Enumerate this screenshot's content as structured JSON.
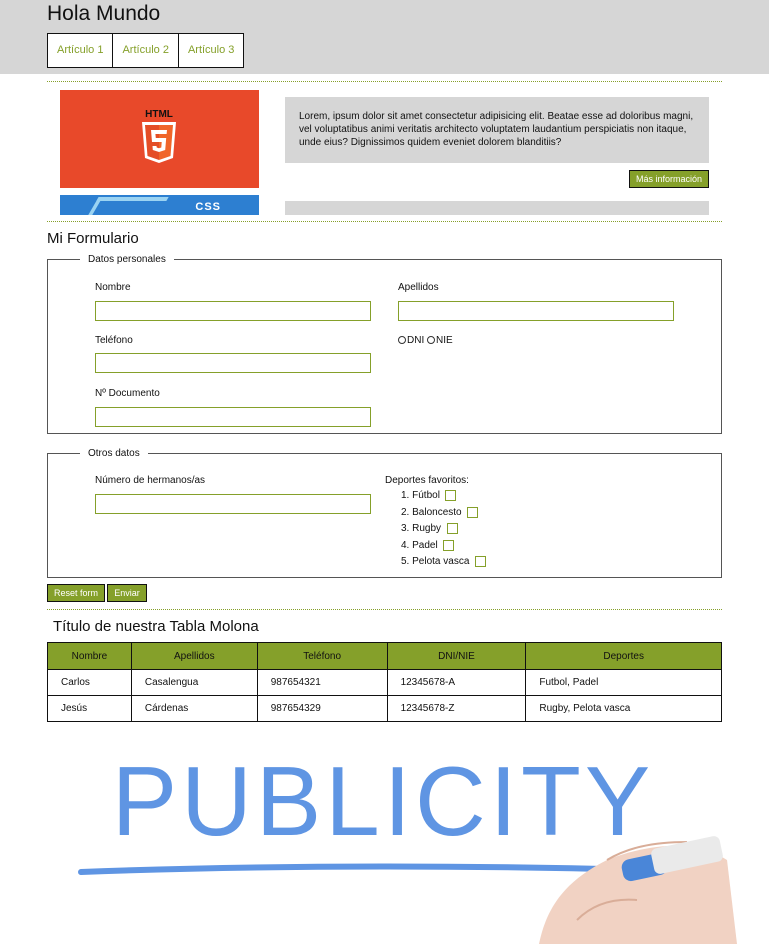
{
  "header": {
    "title": "Hola Mundo",
    "nav": [
      "Artículo 1",
      "Artículo 2",
      "Artículo 3"
    ]
  },
  "article": {
    "image_text": "HTML",
    "image2_text": "CSS",
    "text": "Lorem, ipsum dolor sit amet consectetur adipisicing elit. Beatae esse ad doloribus magni, vel voluptatibus animi veritatis architecto voluptatem laudantium perspiciatis non itaque, unde eius? Dignissimos quidem eveniet dolorem blanditiis?",
    "more_button": "Más información"
  },
  "form": {
    "title": "Mi Formulario",
    "personal": {
      "legend": "Datos personales",
      "nombre_label": "Nombre",
      "apellidos_label": "Apellidos",
      "telefono_label": "Teléfono",
      "dni_label": "DNI",
      "nie_label": "NIE",
      "documento_label": "Nº Documento"
    },
    "other": {
      "legend": "Otros datos",
      "hermanos_label": "Número de hermanos/as",
      "deportes_label": "Deportes favoritos:",
      "sports": [
        "1. Fútbol",
        "2. Baloncesto",
        "3. Rugby",
        "4. Padel",
        "5. Pelota vasca"
      ]
    },
    "reset_button": "Reset form",
    "submit_button": "Enviar"
  },
  "table": {
    "title": "Título de nuestra Tabla Molona",
    "headers": [
      "Nombre",
      "Apellidos",
      "Teléfono",
      "DNI/NIE",
      "Deportes"
    ],
    "rows": [
      [
        "Carlos",
        "Casalengua",
        "987654321",
        "12345678-A",
        "Futbol, Padel"
      ],
      [
        "Jesús",
        "Cárdenas",
        "987654329",
        "12345678-Z",
        "Rugby, Pelota vasca"
      ]
    ]
  },
  "ad": {
    "text": "PUBLICITY"
  },
  "colors": {
    "accent": "#85a02a",
    "header_bg": "#d6d6d6",
    "html5_orange": "#e8492a",
    "ad_blue": "#5f95e3"
  },
  "icons": [
    "html5-shield-icon",
    "css3-logo-icon",
    "radio-icon",
    "checkbox-icon",
    "hand-marker-icon"
  ]
}
